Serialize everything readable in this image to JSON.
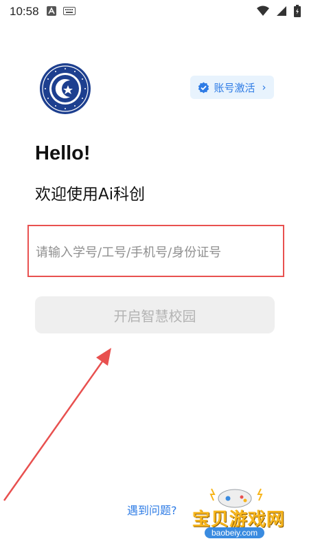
{
  "status_bar": {
    "time": "10:58",
    "left_icons": [
      "font-a-icon",
      "keyboard-icon"
    ],
    "right_icons": [
      "wifi-icon",
      "cell-signal-icon",
      "battery-icon"
    ]
  },
  "header": {
    "logo_icon": "university-seal-logo",
    "activate_label": "账号激活",
    "activate_icon": "verified-badge-icon"
  },
  "greeting": {
    "hello": "Hello!",
    "welcome": "欢迎使用Ai科创"
  },
  "form": {
    "account_placeholder": "请输入学号/工号/手机号/身份证号",
    "account_value": "",
    "submit_label": "开启智慧校园"
  },
  "footer": {
    "help_label": "遇到问题?"
  },
  "watermark": {
    "title": "宝贝游戏网",
    "domain": "baobeiy.com"
  },
  "colors": {
    "accent": "#2d7be5",
    "highlight_border": "#e8504f",
    "button_bg": "#efefef",
    "button_text": "#b3b3b3"
  }
}
